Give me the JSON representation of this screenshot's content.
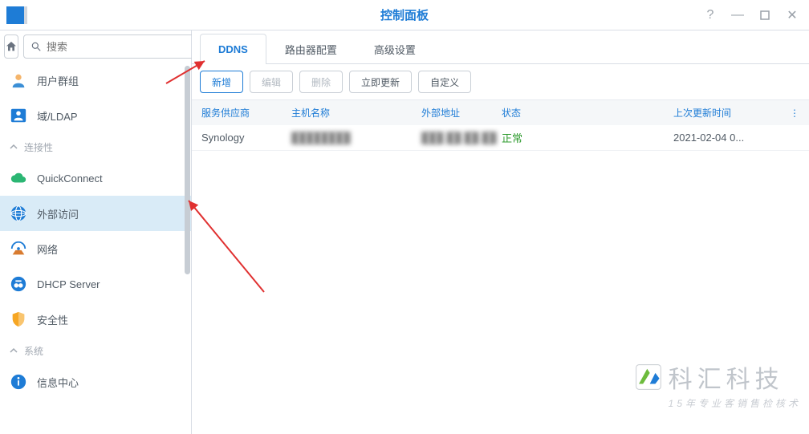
{
  "window": {
    "title": "控制面板"
  },
  "search": {
    "placeholder": "搜索"
  },
  "sidebar": {
    "items": [
      {
        "label": "用户群组"
      },
      {
        "label": "域/LDAP"
      }
    ],
    "group_connectivity": "连接性",
    "conn_items": [
      {
        "label": "QuickConnect"
      },
      {
        "label": "外部访问"
      },
      {
        "label": "网络"
      },
      {
        "label": "DHCP Server"
      },
      {
        "label": "安全性"
      }
    ],
    "group_system": "系统",
    "sys_items": [
      {
        "label": "信息中心"
      }
    ]
  },
  "tabs": [
    {
      "label": "DDNS"
    },
    {
      "label": "路由器配置"
    },
    {
      "label": "高级设置"
    }
  ],
  "toolbar": {
    "add": "新增",
    "edit": "编辑",
    "delete": "删除",
    "update_now": "立即更新",
    "custom": "自定义"
  },
  "table": {
    "headers": {
      "provider": "服务供应商",
      "hostname": "主机名称",
      "external": "外部地址",
      "status": "状态",
      "updated": "上次更新时间"
    },
    "rows": [
      {
        "provider": "Synology",
        "hostname": "████████",
        "external": "███.██.██.██",
        "status": "正常",
        "updated": "2021-02-04 0..."
      }
    ]
  },
  "watermark": {
    "big": "科汇科技",
    "small": "15年专业客销售检核术"
  }
}
